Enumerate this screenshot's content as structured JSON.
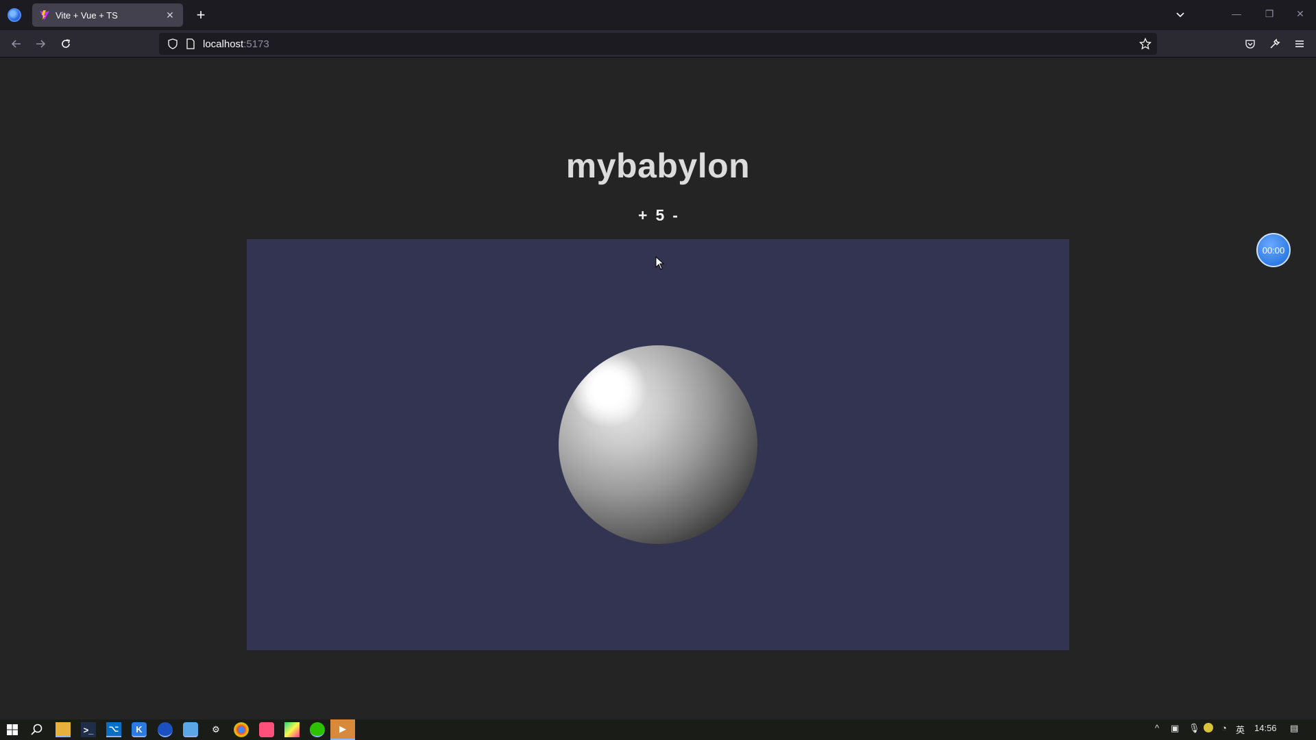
{
  "browser": {
    "tab_title": "Vite + Vue + TS",
    "tab_close": "✕",
    "new_tab": "+",
    "url_host": "localhost",
    "url_port": ":5173",
    "window_minimize": "—",
    "window_restore": "❐",
    "window_close": "✕"
  },
  "page": {
    "title": "mybabylon",
    "counter": {
      "plus": "+",
      "value": "5",
      "minus": "-"
    }
  },
  "overlay": {
    "timer": "00:00"
  },
  "taskbar": {
    "tray_language": "英",
    "clock": "14:56"
  },
  "colors": {
    "page_bg": "#242424",
    "canvas_bg": "#333452",
    "title": "#dcdcdc",
    "timer": "#2f7ce6"
  },
  "icons": {
    "browser_logo": "firefox-icon",
    "tab_favicon": "vite-icon",
    "back": "arrow-left-icon",
    "forward": "arrow-right-icon",
    "reload": "reload-icon",
    "shield": "shield-icon",
    "page": "page-icon",
    "bookmark": "star-icon",
    "pocket": "pocket-icon",
    "tools": "wrench-icon",
    "menu": "hamburger-icon"
  }
}
